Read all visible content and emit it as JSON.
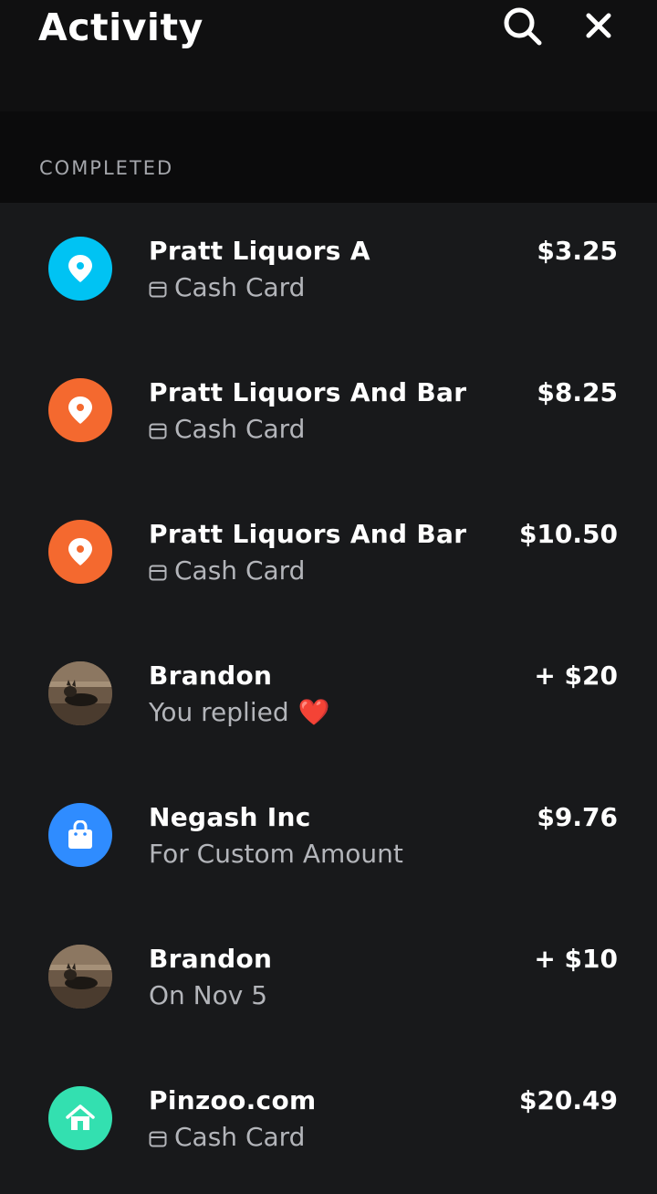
{
  "header": {
    "title": "Activity"
  },
  "section": {
    "label": "COMPLETED"
  },
  "transactions": [
    {
      "name": "Pratt Liquors A",
      "subtitle": "Cash Card",
      "amount": "$3.25",
      "avatar_color": "#00c3f3",
      "icon": "location-pin-icon"
    },
    {
      "name": "Pratt Liquors And Bar",
      "subtitle": "Cash Card",
      "amount": "$8.25",
      "avatar_color": "#f4692f",
      "icon": "location-pin-icon"
    },
    {
      "name": "Pratt Liquors And Bar",
      "subtitle": "Cash Card",
      "amount": "$10.50",
      "avatar_color": "#f4692f",
      "icon": "location-pin-icon"
    },
    {
      "name": "Brandon",
      "subtitle": "You replied",
      "amount": "+ $20",
      "icon": "user-photo",
      "reaction": "❤️"
    },
    {
      "name": "Negash Inc",
      "subtitle": "For Custom Amount",
      "amount": "$9.76",
      "avatar_color": "#2f8cff",
      "icon": "shopping-bag-icon"
    },
    {
      "name": "Brandon",
      "subtitle": "On Nov 5",
      "amount": "+ $10",
      "icon": "user-photo"
    },
    {
      "name": "Pinzoo.com",
      "subtitle": "Cash Card",
      "amount": "$20.49",
      "avatar_color": "#33e0b0",
      "icon": "home-icon"
    }
  ]
}
